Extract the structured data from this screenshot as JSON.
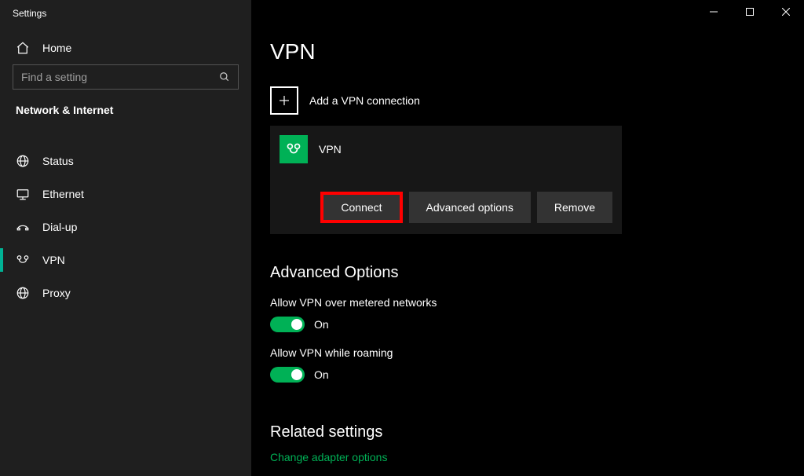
{
  "window": {
    "title": "Settings"
  },
  "sidebar": {
    "home_label": "Home",
    "search_placeholder": "Find a setting",
    "category": "Network & Internet",
    "items": [
      {
        "id": "status",
        "label": "Status"
      },
      {
        "id": "ethernet",
        "label": "Ethernet"
      },
      {
        "id": "dialup",
        "label": "Dial-up"
      },
      {
        "id": "vpn",
        "label": "VPN"
      },
      {
        "id": "proxy",
        "label": "Proxy"
      }
    ]
  },
  "page": {
    "title": "VPN",
    "add_label": "Add a VPN connection",
    "connection": {
      "name": "VPN",
      "buttons": {
        "connect": "Connect",
        "advanced": "Advanced options",
        "remove": "Remove"
      }
    },
    "advanced_heading": "Advanced Options",
    "settings": {
      "metered": {
        "label": "Allow VPN over metered networks",
        "state": "On"
      },
      "roaming": {
        "label": "Allow VPN while roaming",
        "state": "On"
      }
    },
    "related": {
      "heading": "Related settings",
      "link_adapter": "Change adapter options"
    }
  }
}
